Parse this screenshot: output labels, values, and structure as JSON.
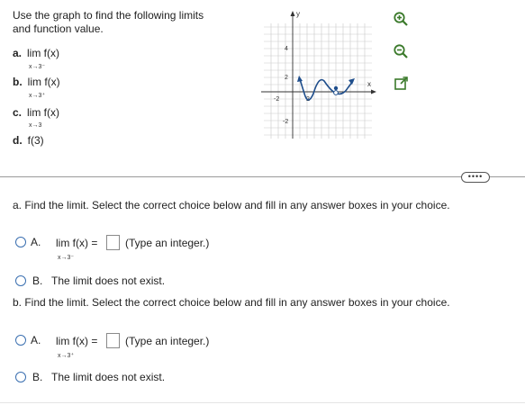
{
  "question": {
    "prompt_line1": "Use the graph to find the following limits",
    "prompt_line2": "and function value.",
    "items": [
      {
        "letter": "a.",
        "text": "lim f(x)",
        "sub": "x→3⁻"
      },
      {
        "letter": "b.",
        "text": "lim f(x)",
        "sub": "x→3⁺"
      },
      {
        "letter": "c.",
        "text": "lim f(x)",
        "sub": "x→3"
      },
      {
        "letter": "d.",
        "text": "f(3)",
        "sub": ""
      }
    ]
  },
  "graph": {
    "y_axis_label": "y",
    "x_axis_label": "x",
    "y_ticks": [
      "4",
      "2",
      "-2"
    ],
    "x_ticks": [
      "-2",
      "2"
    ],
    "icons": [
      "zoom-in-icon",
      "zoom-out-icon",
      "popout-icon"
    ]
  },
  "more_label": "••••",
  "part_a": {
    "instruction": "a. Find the limit. Select the correct choice below and fill in any answer boxes in your choice.",
    "choice_a_letter": "A.",
    "choice_a_lim": "lim f(x) =",
    "choice_a_sub": "x→3⁻",
    "choice_a_hint": "(Type an integer.)",
    "choice_b_letter": "B.",
    "choice_b_text": "The limit does not exist."
  },
  "part_b": {
    "instruction": "b. Find the limit. Select the correct choice below and fill in any answer boxes in your choice.",
    "choice_a_letter": "A.",
    "choice_a_lim": "lim f(x) =",
    "choice_a_sub": "x→3⁺",
    "choice_a_hint": "(Type an integer.)",
    "choice_b_letter": "B.",
    "choice_b_text": "The limit does not exist."
  },
  "colors": {
    "radio_border": "#3a6fb0",
    "icon_fill": "#3b7a2b",
    "graph_curve": "#1f4e8c",
    "divider": "#9a9a9a"
  }
}
